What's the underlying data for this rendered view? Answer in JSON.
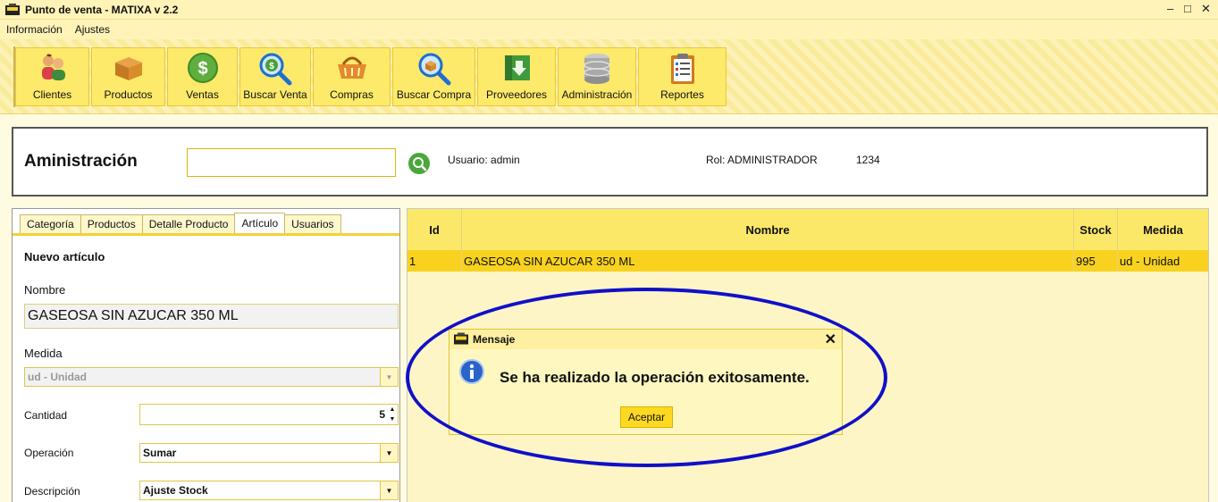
{
  "window": {
    "title": "Punto de venta - MATIXA v 2.2",
    "controls": {
      "minimize": "–",
      "maximize": "□",
      "close": "✕"
    }
  },
  "menu": [
    "Información",
    "Ajustes"
  ],
  "toolbar": [
    {
      "label": "Clientes",
      "icon": "people-icon"
    },
    {
      "label": "Productos",
      "icon": "box-icon"
    },
    {
      "label": "Ventas",
      "icon": "dollar-coin-icon"
    },
    {
      "label": "Buscar Venta",
      "icon": "search-dollar-icon"
    },
    {
      "label": "Compras",
      "icon": "basket-icon"
    },
    {
      "label": "Buscar Compra",
      "icon": "search-box-icon"
    },
    {
      "label": "Proveedores",
      "icon": "download-box-icon"
    },
    {
      "label": "Administración",
      "icon": "database-icon"
    },
    {
      "label": "Reportes",
      "icon": "clipboard-icon"
    }
  ],
  "header": {
    "title": "Aministración",
    "search_value": "",
    "user": "Usuario: admin",
    "role": "Rol: ADMINISTRADOR",
    "code": "1234"
  },
  "tabs": [
    "Categoría",
    "Productos",
    "Detalle Producto",
    "Artículo",
    "Usuarios"
  ],
  "active_tab": "Artículo",
  "form": {
    "heading": "Nuevo artículo",
    "nombre_label": "Nombre",
    "nombre_value": "GASEOSA SIN AZUCAR 350 ML",
    "medida_label": "Medida",
    "medida_value": "ud - Unidad",
    "cantidad_label": "Cantidad",
    "cantidad_value": "5",
    "operacion_label": "Operación",
    "operacion_value": "Sumar",
    "descripcion_label": "Descripción",
    "descripcion_value": "Ajuste Stock"
  },
  "table": {
    "columns": [
      "Id",
      "Nombre",
      "Stock",
      "Medida"
    ],
    "rows": [
      [
        "1",
        "GASEOSA SIN AZUCAR 350 ML",
        "995",
        "ud - Unidad"
      ]
    ]
  },
  "dialog": {
    "title": "Mensaje",
    "message": "Se ha realizado la operación exitosamente.",
    "ok_label": "Aceptar",
    "close": "✕"
  },
  "colors": {
    "accent": "#fde96a",
    "selected_row": "#f8d21f",
    "highlight_ellipse": "#1010c8"
  }
}
